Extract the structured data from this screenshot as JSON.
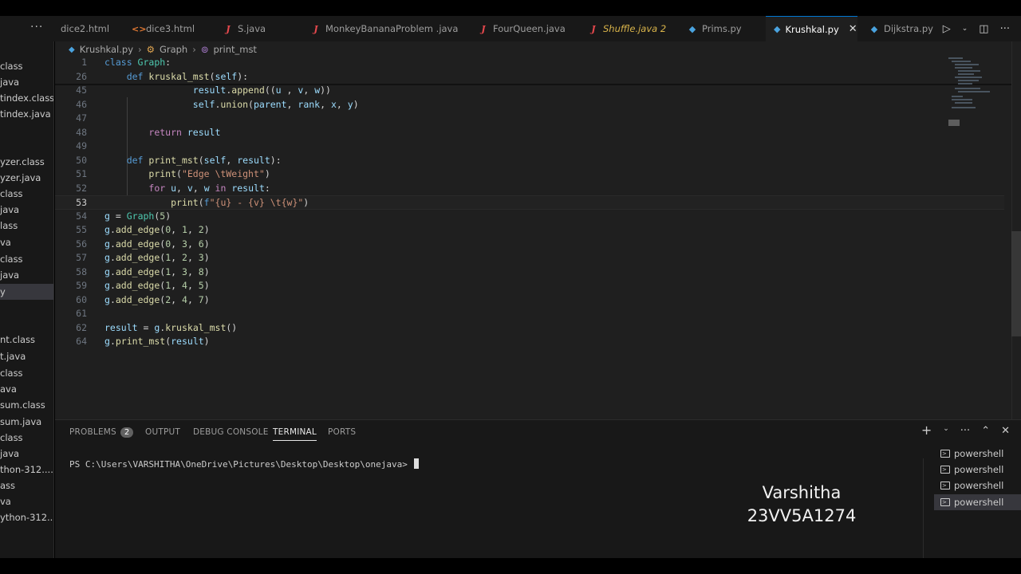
{
  "tabs": [
    {
      "label": "dice2.html",
      "icon": "html"
    },
    {
      "label": "dice3.html",
      "icon": "html"
    },
    {
      "label": "S.java",
      "icon": "java"
    },
    {
      "label": "MonkeyBananaProblem .java",
      "icon": "java"
    },
    {
      "label": "FourQueen.java",
      "icon": "java"
    },
    {
      "label": "Shuffle.java 2",
      "icon": "java"
    },
    {
      "label": "Prims.py",
      "icon": "py"
    },
    {
      "label": "Krushkal.py",
      "icon": "py"
    },
    {
      "label": "Dijkstra.py",
      "icon": "py"
    }
  ],
  "tab_close": "✕",
  "breadcrumb": {
    "file": "Krushkal.py",
    "class": "Graph",
    "method": "print_mst"
  },
  "sidebar": [
    "class",
    "java",
    "tindex.class",
    "tindex.java",
    "",
    "yzer.class",
    "yzer.java",
    "class",
    "java",
    "lass",
    "va",
    "class",
    "java",
    "y",
    "",
    "",
    "nt.class",
    "t.java",
    "class",
    "ava",
    "sum.class",
    "sum.java",
    "class",
    "java",
    "thon-312....",
    "ass",
    "va",
    "ython-312...."
  ],
  "code": {
    "lines": [
      {
        "n": "1",
        "parts": [
          [
            "kw",
            "class "
          ],
          [
            "cls",
            "Graph"
          ],
          [
            "",
            ":"
          ]
        ]
      },
      {
        "n": "26",
        "parts": [
          [
            "",
            "    "
          ],
          [
            "kw",
            "def "
          ],
          [
            "fn",
            "kruskal_mst"
          ],
          [
            "",
            "("
          ],
          [
            "var",
            "self"
          ],
          [
            "",
            "):"
          ]
        ]
      },
      {
        "n": "45",
        "parts": [
          [
            "",
            "                "
          ],
          [
            "var",
            "result"
          ],
          [
            "",
            "."
          ],
          [
            "fn",
            "append"
          ],
          [
            "",
            "(("
          ],
          [
            "var",
            "u"
          ],
          [
            "",
            " , "
          ],
          [
            "var",
            "v"
          ],
          [
            "",
            ", "
          ],
          [
            "var",
            "w"
          ],
          [
            "",
            "))"
          ]
        ]
      },
      {
        "n": "46",
        "parts": [
          [
            "",
            "                "
          ],
          [
            "var",
            "self"
          ],
          [
            "",
            "."
          ],
          [
            "fn",
            "union"
          ],
          [
            "",
            "("
          ],
          [
            "var",
            "parent"
          ],
          [
            "",
            ", "
          ],
          [
            "var",
            "rank"
          ],
          [
            "",
            ", "
          ],
          [
            "var",
            "x"
          ],
          [
            "",
            ", "
          ],
          [
            "var",
            "y"
          ],
          [
            "",
            ")"
          ]
        ]
      },
      {
        "n": "47",
        "parts": []
      },
      {
        "n": "48",
        "parts": [
          [
            "",
            "        "
          ],
          [
            "kw2",
            "return "
          ],
          [
            "var",
            "result"
          ]
        ]
      },
      {
        "n": "49",
        "parts": []
      },
      {
        "n": "50",
        "parts": [
          [
            "",
            "    "
          ],
          [
            "kw",
            "def "
          ],
          [
            "fn",
            "print_mst"
          ],
          [
            "",
            "("
          ],
          [
            "var",
            "self"
          ],
          [
            "",
            ", "
          ],
          [
            "var",
            "result"
          ],
          [
            "",
            "):"
          ]
        ]
      },
      {
        "n": "51",
        "parts": [
          [
            "",
            "        "
          ],
          [
            "fn",
            "print"
          ],
          [
            "",
            "("
          ],
          [
            "str",
            "\"Edge \\tWeight\""
          ],
          [
            "",
            ")"
          ]
        ]
      },
      {
        "n": "52",
        "parts": [
          [
            "",
            "        "
          ],
          [
            "kw2",
            "for "
          ],
          [
            "var",
            "u"
          ],
          [
            "",
            ", "
          ],
          [
            "var",
            "v"
          ],
          [
            "",
            ", "
          ],
          [
            "var",
            "w"
          ],
          [
            "kw2",
            " in "
          ],
          [
            "var",
            "result"
          ],
          [
            "",
            ":"
          ]
        ]
      },
      {
        "n": "53",
        "parts": [
          [
            "",
            "            "
          ],
          [
            "fn",
            "print"
          ],
          [
            "",
            "("
          ],
          [
            "kw",
            "f"
          ],
          [
            "str",
            "\"{u} - {v} \\t{w}\""
          ],
          [
            "",
            ")"
          ]
        ]
      },
      {
        "n": "54",
        "parts": [
          [
            "var",
            "g"
          ],
          [
            "",
            " = "
          ],
          [
            "cls",
            "Graph"
          ],
          [
            "",
            "("
          ],
          [
            "num",
            "5"
          ],
          [
            "",
            ")"
          ]
        ]
      },
      {
        "n": "55",
        "parts": [
          [
            "var",
            "g"
          ],
          [
            "",
            "."
          ],
          [
            "fn",
            "add_edge"
          ],
          [
            "",
            "("
          ],
          [
            "num",
            "0"
          ],
          [
            "",
            ", "
          ],
          [
            "num",
            "1"
          ],
          [
            "",
            ", "
          ],
          [
            "num",
            "2"
          ],
          [
            "",
            ")"
          ]
        ]
      },
      {
        "n": "56",
        "parts": [
          [
            "var",
            "g"
          ],
          [
            "",
            "."
          ],
          [
            "fn",
            "add_edge"
          ],
          [
            "",
            "("
          ],
          [
            "num",
            "0"
          ],
          [
            "",
            ", "
          ],
          [
            "num",
            "3"
          ],
          [
            "",
            ", "
          ],
          [
            "num",
            "6"
          ],
          [
            "",
            ")"
          ]
        ]
      },
      {
        "n": "57",
        "parts": [
          [
            "var",
            "g"
          ],
          [
            "",
            "."
          ],
          [
            "fn",
            "add_edge"
          ],
          [
            "",
            "("
          ],
          [
            "num",
            "1"
          ],
          [
            "",
            ", "
          ],
          [
            "num",
            "2"
          ],
          [
            "",
            ", "
          ],
          [
            "num",
            "3"
          ],
          [
            "",
            ")"
          ]
        ]
      },
      {
        "n": "58",
        "parts": [
          [
            "var",
            "g"
          ],
          [
            "",
            "."
          ],
          [
            "fn",
            "add_edge"
          ],
          [
            "",
            "("
          ],
          [
            "num",
            "1"
          ],
          [
            "",
            ", "
          ],
          [
            "num",
            "3"
          ],
          [
            "",
            ", "
          ],
          [
            "num",
            "8"
          ],
          [
            "",
            ")"
          ]
        ]
      },
      {
        "n": "59",
        "parts": [
          [
            "var",
            "g"
          ],
          [
            "",
            "."
          ],
          [
            "fn",
            "add_edge"
          ],
          [
            "",
            "("
          ],
          [
            "num",
            "1"
          ],
          [
            "",
            ", "
          ],
          [
            "num",
            "4"
          ],
          [
            "",
            ", "
          ],
          [
            "num",
            "5"
          ],
          [
            "",
            ")"
          ]
        ]
      },
      {
        "n": "60",
        "parts": [
          [
            "var",
            "g"
          ],
          [
            "",
            "."
          ],
          [
            "fn",
            "add_edge"
          ],
          [
            "",
            "("
          ],
          [
            "num",
            "2"
          ],
          [
            "",
            ", "
          ],
          [
            "num",
            "4"
          ],
          [
            "",
            ", "
          ],
          [
            "num",
            "7"
          ],
          [
            "",
            ")"
          ]
        ]
      },
      {
        "n": "61",
        "parts": []
      },
      {
        "n": "62",
        "parts": [
          [
            "var",
            "result"
          ],
          [
            "",
            " = "
          ],
          [
            "var",
            "g"
          ],
          [
            "",
            "."
          ],
          [
            "fn",
            "kruskal_mst"
          ],
          [
            "",
            "()"
          ]
        ]
      },
      {
        "n": "64",
        "parts": [
          [
            "var",
            "g"
          ],
          [
            "",
            "."
          ],
          [
            "fn",
            "print_mst"
          ],
          [
            "",
            "("
          ],
          [
            "var",
            "result"
          ],
          [
            "",
            ")"
          ]
        ]
      }
    ],
    "current_line": "53"
  },
  "panel": {
    "tabs": {
      "problems": "PROBLEMS",
      "output": "OUTPUT",
      "debug": "DEBUG CONSOLE",
      "terminal": "TERMINAL",
      "ports": "PORTS"
    },
    "problems_count": "2",
    "prompt": "PS C:\\Users\\VARSHITHA\\OneDrive\\Pictures\\Desktop\\Desktop\\onejava>",
    "terminals": [
      "powershell",
      "powershell",
      "powershell",
      "powershell"
    ]
  },
  "watermark": {
    "name": "Varshitha",
    "id": "23VV5A1274"
  }
}
